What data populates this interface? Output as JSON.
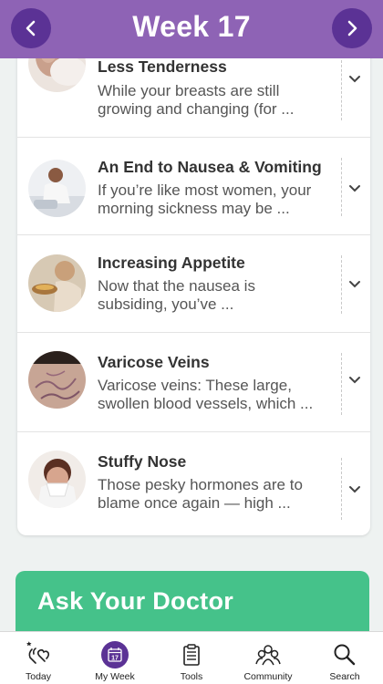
{
  "header": {
    "title": "Week 17",
    "prev_icon": "chevron-left-icon",
    "next_icon": "chevron-right-icon",
    "color": "#8e63b5",
    "button_color": "#5b3295"
  },
  "symptoms": [
    {
      "title": "Less Tenderness",
      "desc1": "While your breasts are still",
      "desc2": "growing and changing (for ...",
      "image": "pregnant-belly-photo"
    },
    {
      "title": "An End to Nausea & Vomiting",
      "desc1": "If you’re like most women, your",
      "desc2": "morning sickness may be ...",
      "image": "woman-at-sink-photo"
    },
    {
      "title": "Increasing Appetite",
      "desc1": "Now that the nausea is",
      "desc2": "subsiding, you’ve ...",
      "image": "woman-eating-photo"
    },
    {
      "title": "Varicose Veins",
      "desc1": "Varicose veins: These large,",
      "desc2": "swollen blood vessels, which ...",
      "image": "varicose-veins-photo"
    },
    {
      "title": "Stuffy Nose",
      "desc1": "Those pesky hormones are to",
      "desc2": "blame once again — high ...",
      "image": "woman-blowing-nose-photo"
    }
  ],
  "ask": {
    "title": "Ask Your Doctor",
    "color": "#45c28a"
  },
  "tabbar": {
    "tabs": [
      {
        "label": "Today",
        "icon": "today-icon"
      },
      {
        "label": "My Week",
        "icon": "calendar-icon",
        "badge": "17",
        "active": true
      },
      {
        "label": "Tools",
        "icon": "clipboard-icon"
      },
      {
        "label": "Community",
        "icon": "community-icon"
      },
      {
        "label": "Search",
        "icon": "search-icon"
      }
    ]
  }
}
